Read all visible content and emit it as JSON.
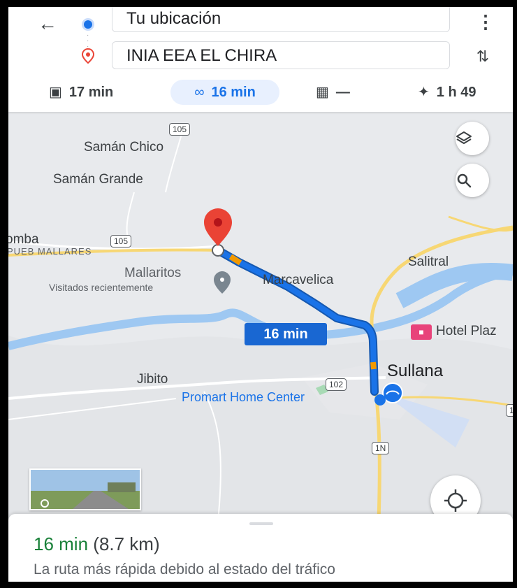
{
  "header": {
    "origin": "Tu ubicación",
    "destination": "INIA EEA EL CHIRA",
    "modes": [
      {
        "icon": "car-icon",
        "label": "17 min"
      },
      {
        "icon": "motorcycle-icon",
        "label": "16 min"
      },
      {
        "icon": "transit-icon",
        "label": "—"
      },
      {
        "icon": "walk-icon",
        "label": "1 h 49"
      }
    ],
    "selected_mode": "motorcycle"
  },
  "map": {
    "places": {
      "saman_chico": "Samán Chico",
      "saman_grande": "Samán Grande",
      "pueb_mallares": "PUEB MALLARES",
      "omba": "omba",
      "mallaritos": "Mallaritos",
      "visitados": "Visitados recientemente",
      "marcavelica": "Marcavelica",
      "salitral": "Salitral",
      "hotel": "Hotel Plaz",
      "sullana": "Sullana",
      "jibito": "Jibito",
      "promart": "Promart Home Center"
    },
    "shields": {
      "r105_top": "105",
      "r105_mid": "105",
      "r102": "102",
      "r1n": "1N",
      "r1_edge": "1"
    },
    "route_eta": "16 min",
    "colors": {
      "route": "#1a73e8",
      "traffic": "#f29900",
      "pin": "#ea4335",
      "water": "#9ec8f2"
    }
  },
  "sheet": {
    "time": "16 min",
    "distance": "(8.7 km)",
    "description": "La ruta más rápida debido al estado del tráfico"
  }
}
